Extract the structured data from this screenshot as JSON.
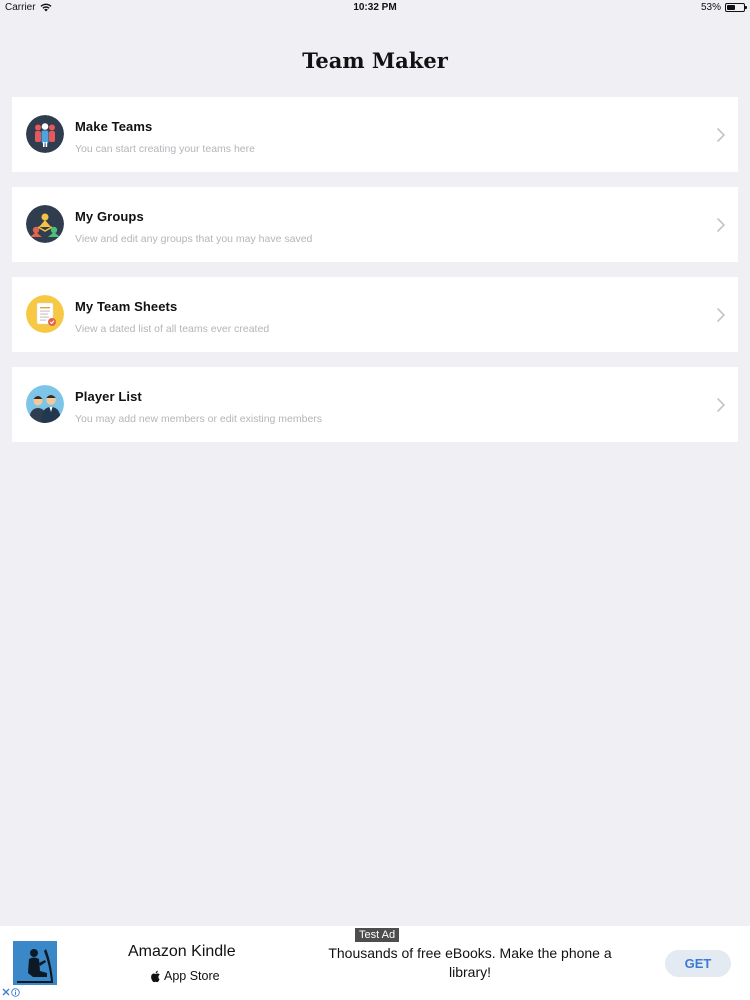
{
  "status_bar": {
    "carrier": "Carrier",
    "time": "10:32 PM",
    "battery_text": "53%",
    "battery_level": 0.53
  },
  "nav": {
    "title": "Team Maker"
  },
  "menu": [
    {
      "title": "Make Teams",
      "subtitle": "You can start creating your teams here",
      "icon": "team-people-icon"
    },
    {
      "title": "My Groups",
      "subtitle": "View and edit any groups that you may have saved",
      "icon": "groups-icon"
    },
    {
      "title": "My Team Sheets",
      "subtitle": "View a dated list of all teams ever created",
      "icon": "team-sheets-icon"
    },
    {
      "title": "Player List",
      "subtitle": "You may add new members or edit existing members",
      "icon": "players-icon"
    }
  ],
  "ad": {
    "tag": "Test Ad",
    "app_name": "Amazon Kindle",
    "store": "App Store",
    "description": "Thousands of free eBooks. Make the phone a library!",
    "cta": "GET"
  },
  "colors": {
    "background": "#efeff4",
    "card": "#ffffff",
    "subtitle": "#b5b5bb",
    "cta_text": "#3b7bd4"
  }
}
